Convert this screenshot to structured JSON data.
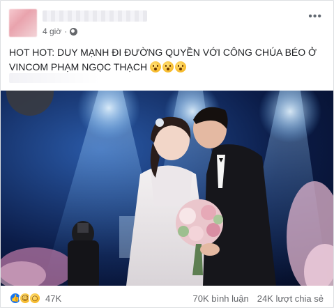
{
  "post": {
    "author_name": "",
    "time": "4 giờ",
    "separator": "·",
    "privacy_icon": "globe-icon",
    "more_icon": "more-horizontal-icon",
    "more_label": "•••",
    "text": "HOT HOT: DUY MẠNH ĐI ĐƯỜNG QUYỀN VỚI CÔNG CHÚA BÉO Ở VINCOM PHẠM NGỌC THẠCH",
    "text_emojis": [
      "astonished-emoji",
      "astonished-emoji",
      "astonished-emoji"
    ]
  },
  "photo": {
    "subject": "wedding-couple-stage-photo"
  },
  "stats": {
    "reaction_icons": [
      "like-icon",
      "haha-icon",
      "wow-icon"
    ],
    "reaction_count": "47K",
    "comments": "70K bình luận",
    "shares": "24K lượt chia sẻ"
  },
  "colors": {
    "accent": "#1877f2",
    "secondary_text": "#65676b",
    "emoji_yellow": "#f7b928"
  }
}
